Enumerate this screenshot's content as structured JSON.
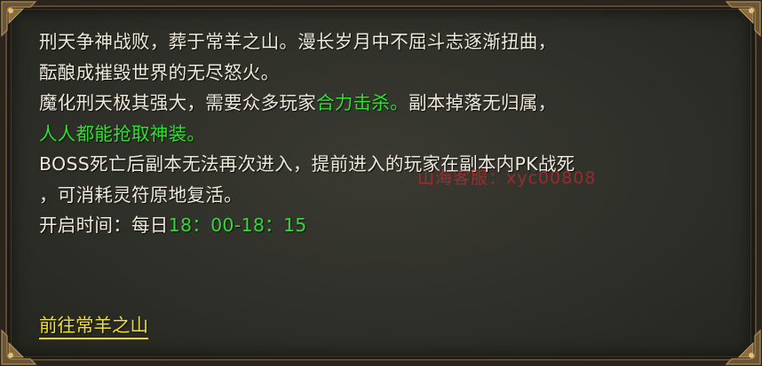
{
  "description": {
    "line1": "刑天争神战败，葬于常羊之山。漫长岁月中不屈斗志逐渐扭曲，",
    "line2": "酝酿成摧毁世界的无尽怒火。",
    "line3_a": "魔化刑天极其强大，需要众多玩家",
    "line3_highlight": "合力击杀。",
    "line3_b": "副本掉落无归属，",
    "line4_highlight": "人人都能抢取神装。",
    "line5": "BOSS死亡后副本无法再次进入，提前进入的玩家在副本内PK战死",
    "line6": "，可消耗灵符原地复活。",
    "open_time_label": "开启时间：每日",
    "open_time_value": "18：00-18：15"
  },
  "watermark": "山海客服：xyc00808",
  "goto_link": "前往常羊之山",
  "colors": {
    "text": "#efe9dc",
    "highlight_green": "#2fe02f",
    "link_yellow": "#f0e02a",
    "watermark_red": "#e62828"
  }
}
